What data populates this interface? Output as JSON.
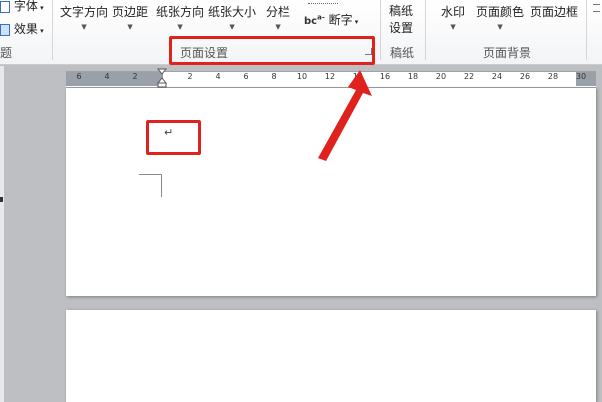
{
  "ribbon": {
    "font_group": {
      "font_label": "字体",
      "effects_label": "效果",
      "group_label": "题"
    },
    "page_setup_group": {
      "text_direction": "文字方向",
      "margins": "页边距",
      "orientation": "纸张方向",
      "size": "纸张大小",
      "columns": "分栏",
      "hyphenation": "断字",
      "group_label": "页面设置"
    },
    "manuscript_group": {
      "line1": "稿纸",
      "line2": "设置",
      "group_label": "稿纸"
    },
    "background_group": {
      "watermark": "水印",
      "page_color": "页面颜色",
      "page_borders": "页面边框",
      "group_label": "页面背景"
    }
  },
  "ruler": {
    "left_marks": [
      "6",
      "4",
      "2"
    ],
    "right_marks": [
      "2",
      "4",
      "6",
      "8",
      "10",
      "12",
      "14",
      "16",
      "18",
      "20",
      "22",
      "24",
      "26",
      "28",
      "30"
    ]
  },
  "document": {
    "paragraph_mark": "↵"
  },
  "annotation": {
    "highlight_color": "#e0221e"
  },
  "icons": [
    "dialog-launcher-icon",
    "hyphenation-icon",
    "dropdown-arrow-icon"
  ]
}
